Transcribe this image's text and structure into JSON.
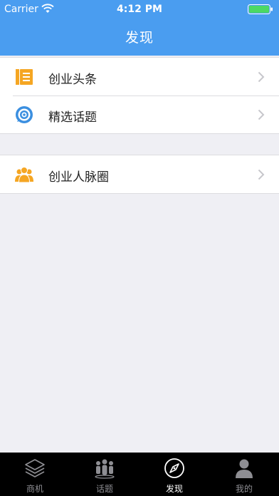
{
  "status_bar": {
    "carrier": "Carrier",
    "time": "4:12 PM",
    "wifi_icon": "wifi-icon",
    "battery_icon": "battery-icon"
  },
  "nav": {
    "title": "发现"
  },
  "colors": {
    "header_bg": "#4a9df0",
    "icon_orange": "#f5a623",
    "icon_blue": "#3b8fe0",
    "page_bg": "#efeff4",
    "tabbar_bg": "#000000"
  },
  "sections": [
    {
      "items": [
        {
          "label": "创业头条",
          "icon": "newspaper-icon"
        },
        {
          "label": "精选话题",
          "icon": "target-chat-icon"
        }
      ]
    },
    {
      "items": [
        {
          "label": "创业人脉圈",
          "icon": "people-icon"
        }
      ]
    }
  ],
  "tabbar": {
    "tabs": [
      {
        "label": "商机",
        "icon": "layers-icon",
        "active": false
      },
      {
        "label": "话题",
        "icon": "group-icon",
        "active": false
      },
      {
        "label": "发现",
        "icon": "compass-icon",
        "active": true
      },
      {
        "label": "我的",
        "icon": "person-icon",
        "active": false
      }
    ]
  }
}
